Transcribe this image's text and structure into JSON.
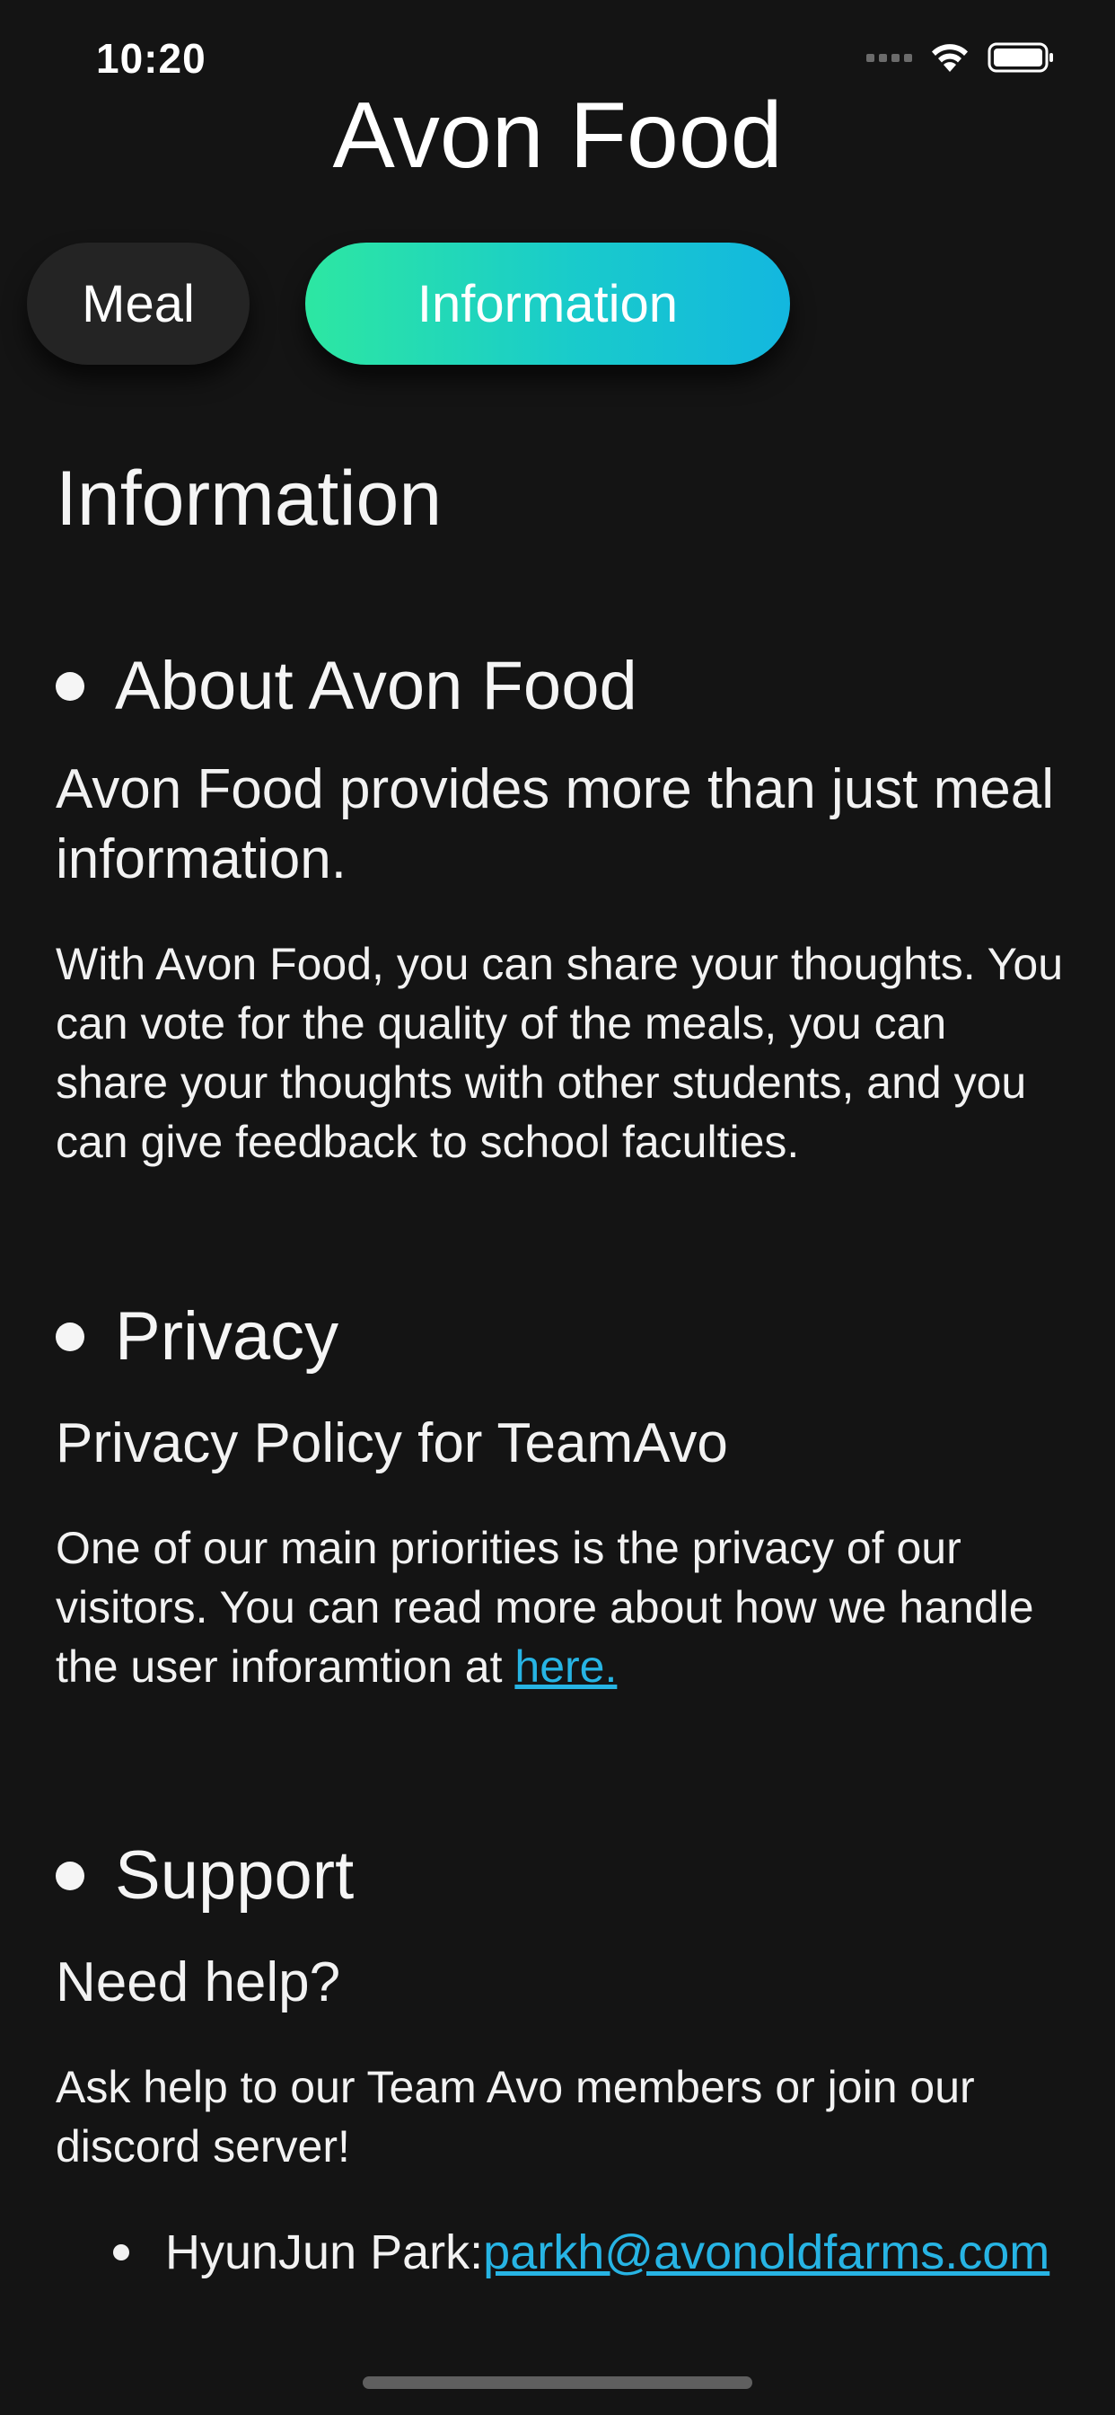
{
  "status_bar": {
    "time": "10:20",
    "icons": [
      "cellular-signal-icon",
      "wifi-icon",
      "battery-icon"
    ]
  },
  "app": {
    "title": "Avon Food"
  },
  "tabs": [
    {
      "label": "Meal",
      "selected": false
    },
    {
      "label": "Information",
      "selected": true
    }
  ],
  "page": {
    "heading": "Information",
    "sections": {
      "about": {
        "title": "About Avon Food",
        "lead": "Avon Food provides more than just meal information.",
        "body": "With Avon Food, you can share your thoughts. You can vote for the quality of the meals, you can share your thoughts with other students, and you can give feedback to school faculties."
      },
      "privacy": {
        "title": "Privacy",
        "lead": "Privacy Policy for TeamAvo",
        "body": "One of our main priorities is the privacy of our visitors. You can read more about how we handle the user inforamtion at ",
        "link_text": "here."
      },
      "support": {
        "title": "Support",
        "lead": "Need help?",
        "body": "Ask help to our Team Avo members or join our discord server!",
        "contacts": [
          {
            "name": "HyunJun Park: ",
            "email": "parkh@avonoldfarms.com"
          }
        ]
      }
    }
  },
  "colors": {
    "background": "#141414",
    "accent_gradient_start": "#2de7a2",
    "accent_gradient_end": "#13b7df",
    "link": "#27b4e4",
    "tab_inactive": "#242424"
  }
}
